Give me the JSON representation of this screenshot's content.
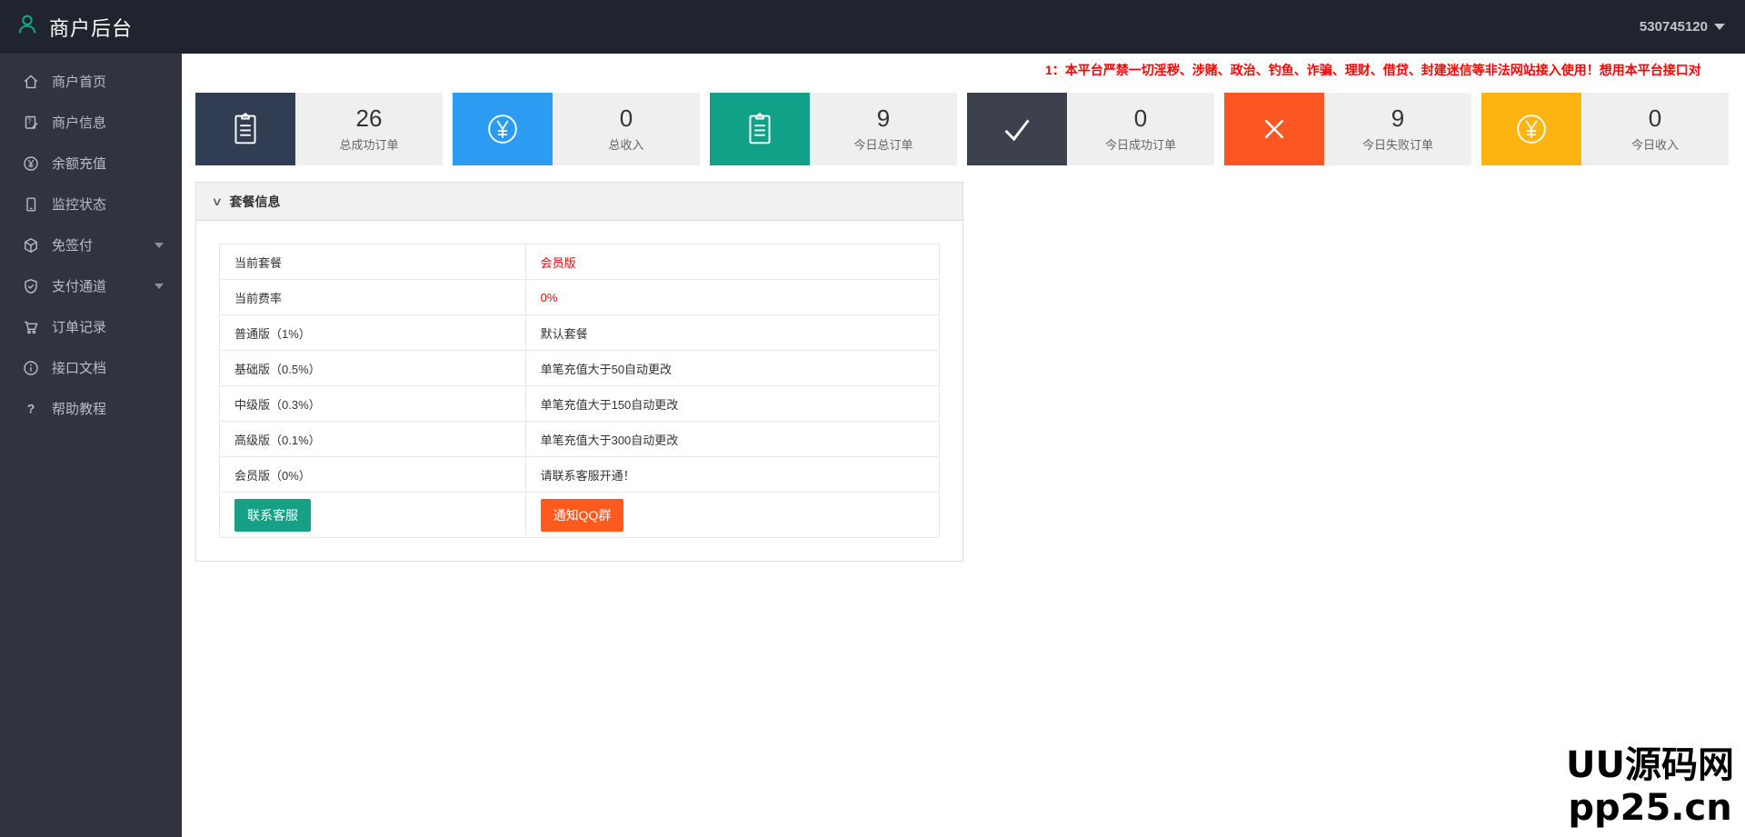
{
  "topbar": {
    "title": "商户后台",
    "account": "530745120"
  },
  "sidebar": {
    "items": [
      {
        "label": "商户首页"
      },
      {
        "label": "商户信息"
      },
      {
        "label": "余额充值"
      },
      {
        "label": "监控状态"
      },
      {
        "label": "免签付"
      },
      {
        "label": "支付通道"
      },
      {
        "label": "订单记录"
      },
      {
        "label": "接口文档"
      },
      {
        "label": "帮助教程"
      }
    ]
  },
  "notice": "1：本平台严禁一切淫秽、涉赌、政治、钓鱼、诈骗、理财、借贷、封建迷信等非法网站接入使用！想用本平台接口对",
  "stats": [
    {
      "value": "26",
      "label": "总成功订单",
      "icon": "clipboard-icon",
      "color": "#313d52"
    },
    {
      "value": "0",
      "label": "总收入",
      "icon": "yen-icon",
      "color": "#2b9cf2"
    },
    {
      "value": "9",
      "label": "今日总订单",
      "icon": "clipboard-icon",
      "color": "#10a188"
    },
    {
      "value": "0",
      "label": "今日成功订单",
      "icon": "check-icon",
      "color": "#3d414d"
    },
    {
      "value": "9",
      "label": "今日失败订单",
      "icon": "x-icon",
      "color": "#fc5622"
    },
    {
      "value": "0",
      "label": "今日收入",
      "icon": "yen-icon",
      "color": "#fcb410"
    }
  ],
  "panel": {
    "title": "套餐信息",
    "rows": [
      {
        "label": "当前套餐",
        "value": "会员版"
      },
      {
        "label": "当前费率",
        "value": "0%"
      },
      {
        "label": "普通版（1%）",
        "value": "默认套餐"
      },
      {
        "label": "基础版（0.5%）",
        "value": "单笔充值大于50自动更改"
      },
      {
        "label": "中级版（0.3%）",
        "value": "单笔充值大于150自动更改"
      },
      {
        "label": "高级版（0.1%）",
        "value": "单笔充值大于300自动更改"
      },
      {
        "label": "会员版（0%）",
        "value": "请联系客服开通！"
      }
    ],
    "buttons": [
      {
        "label": "联系客服",
        "color": "#16a085"
      },
      {
        "label": "通知QQ群",
        "color": "#ff5a1e"
      }
    ]
  },
  "watermark": {
    "line1": "UU源码网",
    "line2": "pp25.cn"
  }
}
